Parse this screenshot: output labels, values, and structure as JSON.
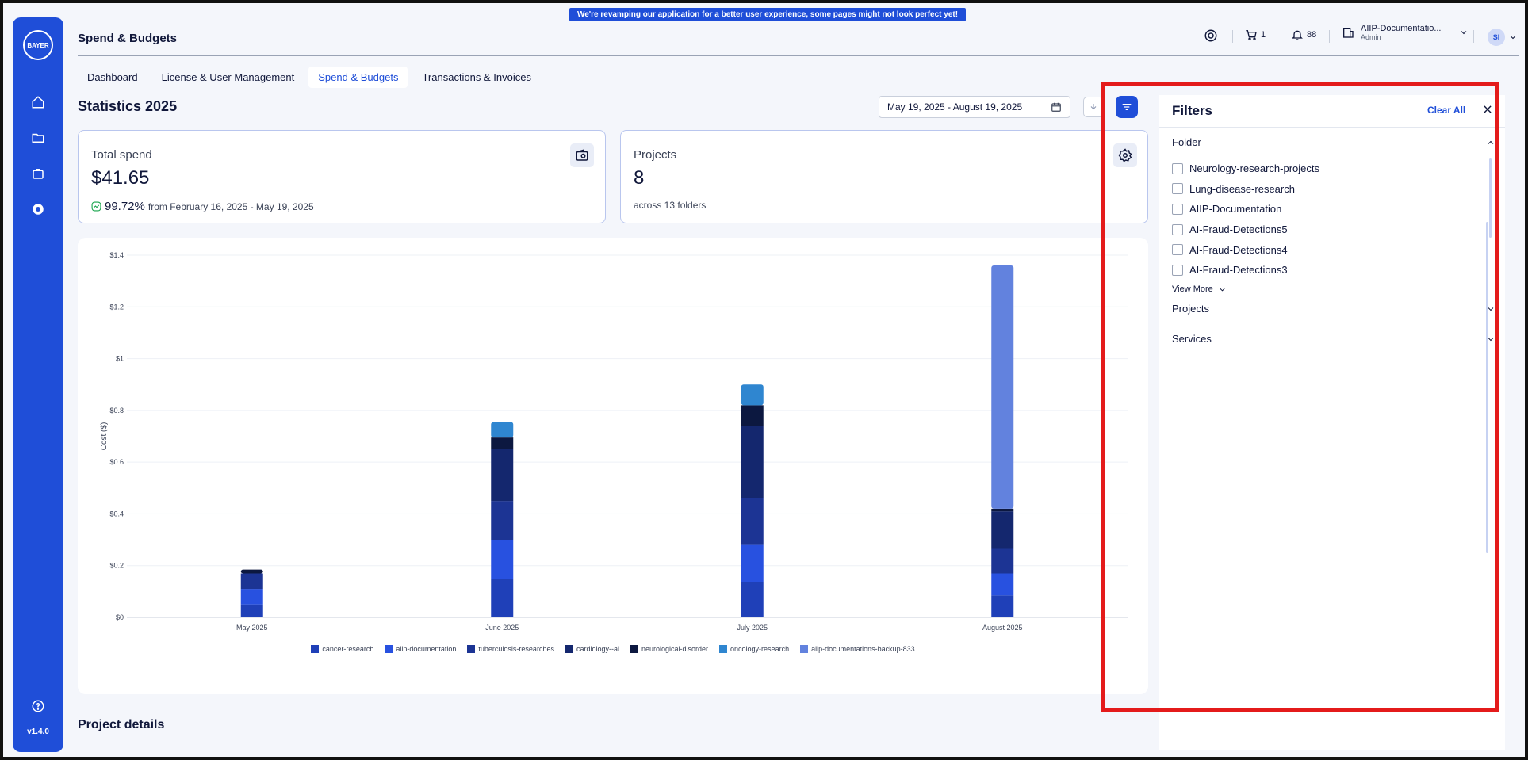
{
  "banner": "We're revamping our application for a better user experience, some pages might not look perfect yet!",
  "rail": {
    "logo_text": "BAYER",
    "version": "v1.4.0"
  },
  "header": {
    "title": "Spend & Budgets",
    "cart_count": "1",
    "notification_count": "88",
    "account_name": "AIIP-Documentatio...",
    "account_role": "Admin",
    "avatar_initials": "SI"
  },
  "tabs": [
    {
      "label": "Dashboard"
    },
    {
      "label": "License & User Management"
    },
    {
      "label": "Spend & Budgets",
      "active": true
    },
    {
      "label": "Transactions & Invoices"
    }
  ],
  "statistics": {
    "title": "Statistics 2025",
    "date_range": "May 19, 2025 - August 19, 2025"
  },
  "cards": {
    "total_spend": {
      "label": "Total spend",
      "value": "$41.65",
      "change_pct": "99.72%",
      "change_text": "from February 16, 2025 - May 19, 2025"
    },
    "projects": {
      "label": "Projects",
      "value": "8",
      "sub": "across 13 folders"
    }
  },
  "chart_data": {
    "type": "bar",
    "stacked": true,
    "categories": [
      "May 2025",
      "June 2025",
      "July 2025",
      "August 2025"
    ],
    "ylabel": "Cost ($)",
    "ylim": [
      0,
      1.4
    ],
    "y_ticks": [
      "$0",
      "$0.2",
      "$0.4",
      "$0.6",
      "$0.8",
      "$1",
      "$1.2",
      "$1.4"
    ],
    "grid": true,
    "legend_position": "bottom",
    "series": [
      {
        "name": "cancer-research",
        "color": "#1f40b8",
        "values": [
          0.05,
          0.15,
          0.135,
          0.085
        ]
      },
      {
        "name": "aiip-documentation",
        "color": "#2851e0",
        "values": [
          0.06,
          0.15,
          0.145,
          0.085
        ]
      },
      {
        "name": "tuberculosis-researches",
        "color": "#1c3494",
        "values": [
          0.06,
          0.15,
          0.18,
          0.095
        ]
      },
      {
        "name": "cardiology--ai",
        "color": "#14276e",
        "values": [
          0.0,
          0.2,
          0.28,
          0.145
        ]
      },
      {
        "name": "neurological-disorder",
        "color": "#0c1840",
        "values": [
          0.015,
          0.045,
          0.08,
          0.01
        ]
      },
      {
        "name": "oncology-research",
        "color": "#2f86d0",
        "values": [
          0.0,
          0.06,
          0.08,
          0.0
        ]
      },
      {
        "name": "aiip-documentations-backup-833",
        "color": "#6282de",
        "values": [
          0.0,
          0.0,
          0.0,
          0.94
        ]
      }
    ]
  },
  "project_details": {
    "title": "Project details"
  },
  "filters": {
    "title": "Filters",
    "clear_all": "Clear All",
    "folder": {
      "label": "Folder",
      "items": [
        "Neurology-research-projects",
        "Lung-disease-research",
        "AIIP-Documentation",
        "AI-Fraud-Detections5",
        "AI-Fraud-Detections4",
        "AI-Fraud-Detections3"
      ],
      "view_more": "View More"
    },
    "projects_label": "Projects",
    "services_label": "Services"
  },
  "colors": {
    "brand": "#1f4ed8",
    "highlight": "#e41b1b",
    "positive": "#16a34a"
  }
}
